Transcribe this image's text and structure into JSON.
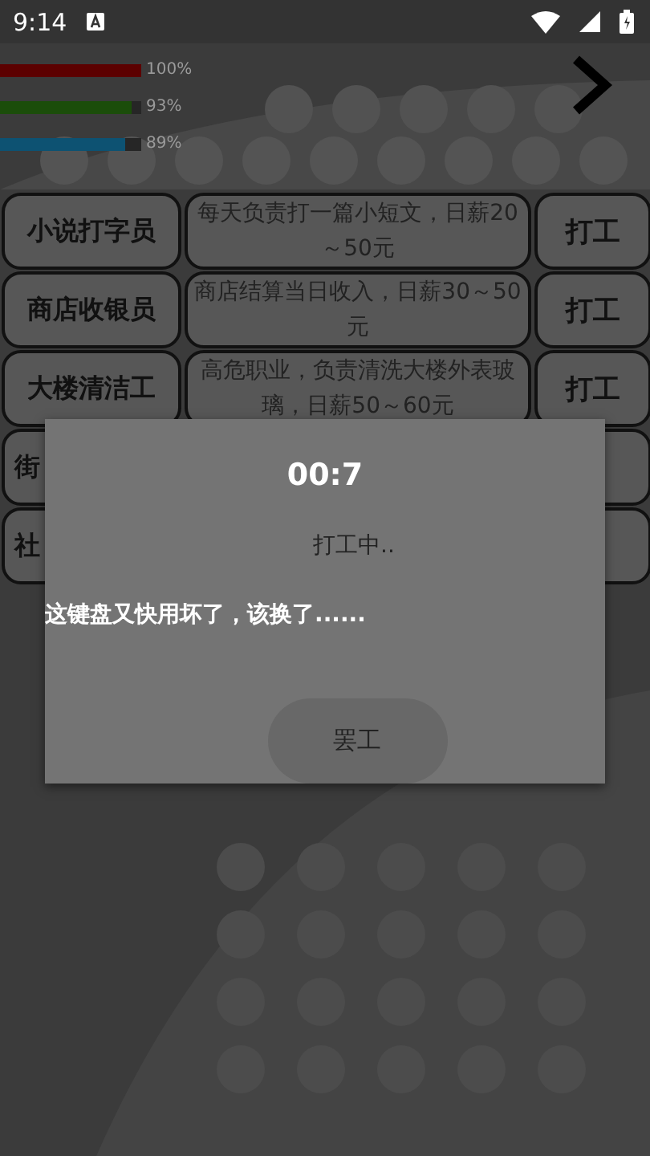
{
  "status_bar": {
    "time": "9:14"
  },
  "stats": [
    {
      "level": 1,
      "reading": "100%",
      "color": "#5c0000"
    },
    {
      "level": 0.93,
      "reading": "93%",
      "color": "#1b4d0a"
    },
    {
      "level": 0.89,
      "reading": "89%",
      "color": "#0d5272"
    }
  ],
  "jobs": [
    {
      "name": "小说打字员",
      "description": "每天负责打一篇小短文，日薪20～50元",
      "action": "打工"
    },
    {
      "name": "商店收银员",
      "description": "商店结算当日收入，日薪30～50元",
      "action": "打工"
    },
    {
      "name": "大楼清洁工",
      "description": "高危职业，负责清洗大楼外表玻璃，日薪50～60元",
      "action": "打工"
    },
    {
      "name": "街"
    },
    {
      "name": "社"
    }
  ],
  "dialog": {
    "timer": "00:7",
    "status": "打工中..",
    "message": "这键盘又快用坏了，该换了......",
    "button": "罢工"
  }
}
